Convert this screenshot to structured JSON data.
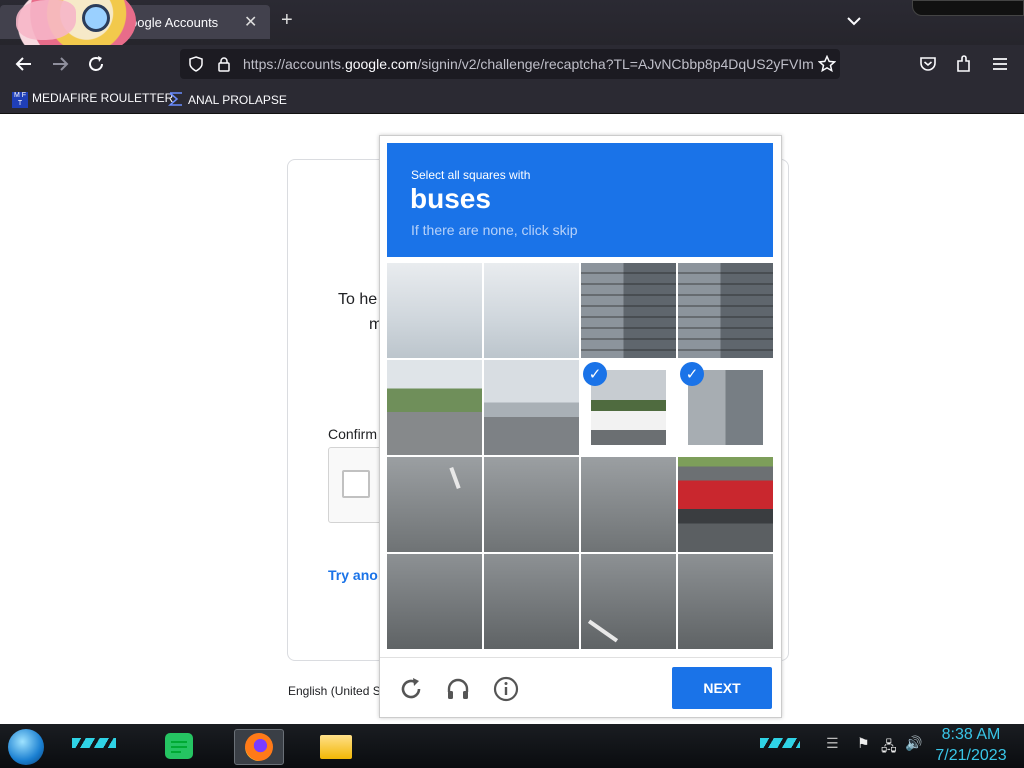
{
  "browser": {
    "tab_title": "oogle Accounts",
    "tab_close": "✕",
    "new_tab": "+",
    "url_prefix": "https://accounts.",
    "url_domain": "google.com",
    "url_rest": "/signin/v2/challenge/recaptcha?TL=AJvNCbbp8p4DqUS2yFVIm",
    "bookmarks": [
      {
        "label": "MEDIAFIRE ROULETTER",
        "icon": "mediafire-icon"
      },
      {
        "label": "ANAL PROLAPSE",
        "icon": "sigma-icon"
      }
    ]
  },
  "page": {
    "help_text_1": "To he",
    "help_text_2": "m",
    "confirm_label": "Confirm",
    "try_link": "Try ano",
    "footer_lang": "English (United S"
  },
  "captcha": {
    "instruction_small": "Select all squares with",
    "target": "buses",
    "hint": "If there are none, click skip",
    "selected_tiles": [
      6,
      7
    ],
    "next_label": "NEXT",
    "reload_icon": "reload-icon",
    "audio_icon": "headphones-icon",
    "info_icon": "info-icon"
  },
  "taskbar": {
    "time": "8:38 AM",
    "date": "7/21/2023"
  },
  "colors": {
    "accent_blue": "#1a73e8",
    "chrome_dark": "#2b2a33",
    "tray_cyan": "#39c6e8"
  }
}
